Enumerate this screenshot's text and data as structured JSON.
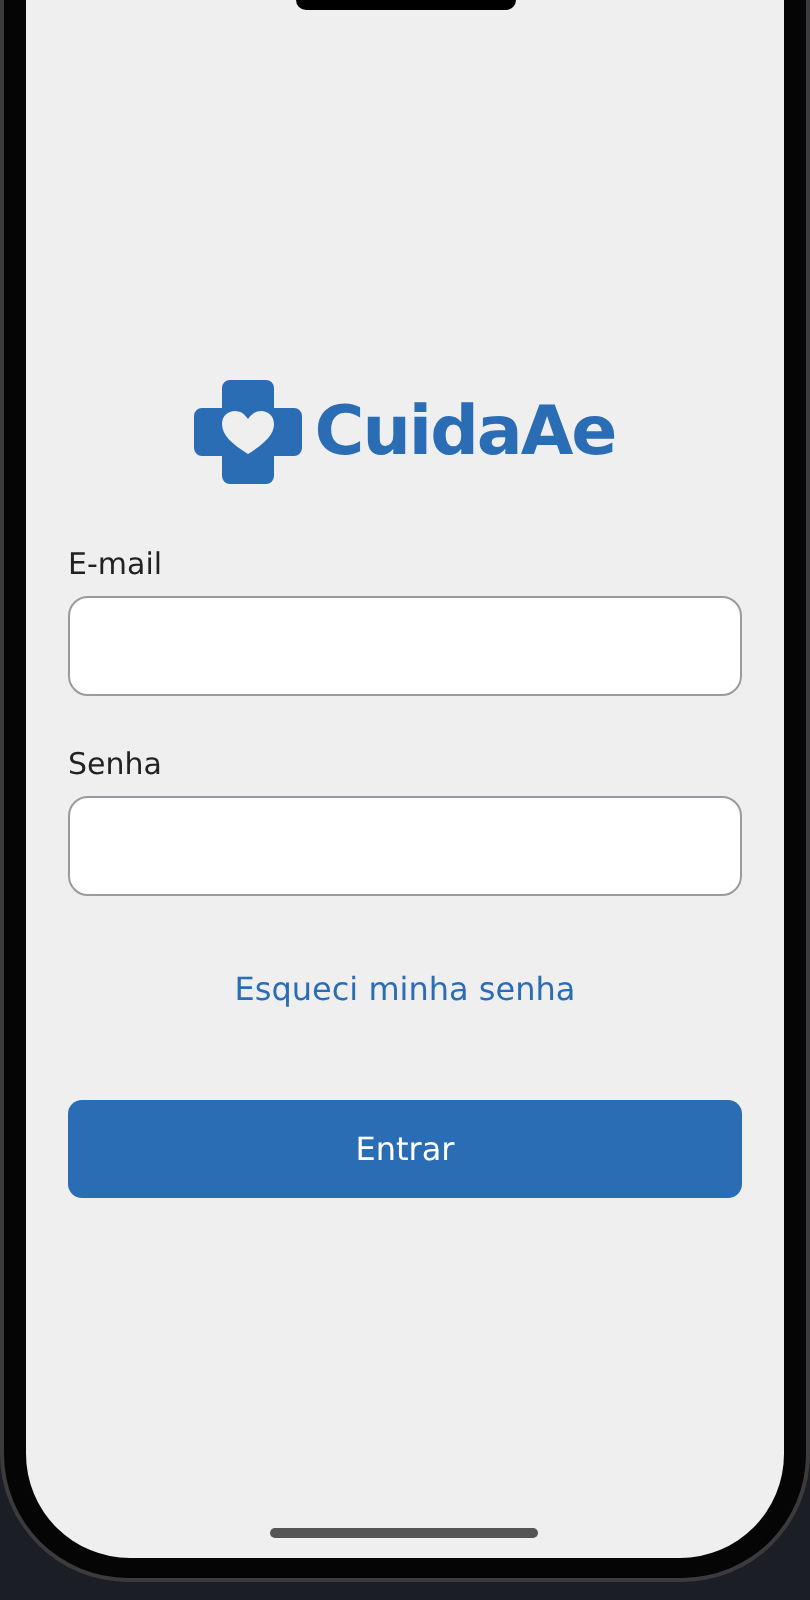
{
  "logo": {
    "text": "CuidaAe"
  },
  "fields": [
    {
      "label": "E-mail"
    },
    {
      "label": "Senha"
    }
  ],
  "forgot_link": "Esqueci minha senha",
  "button": "Entrar"
}
